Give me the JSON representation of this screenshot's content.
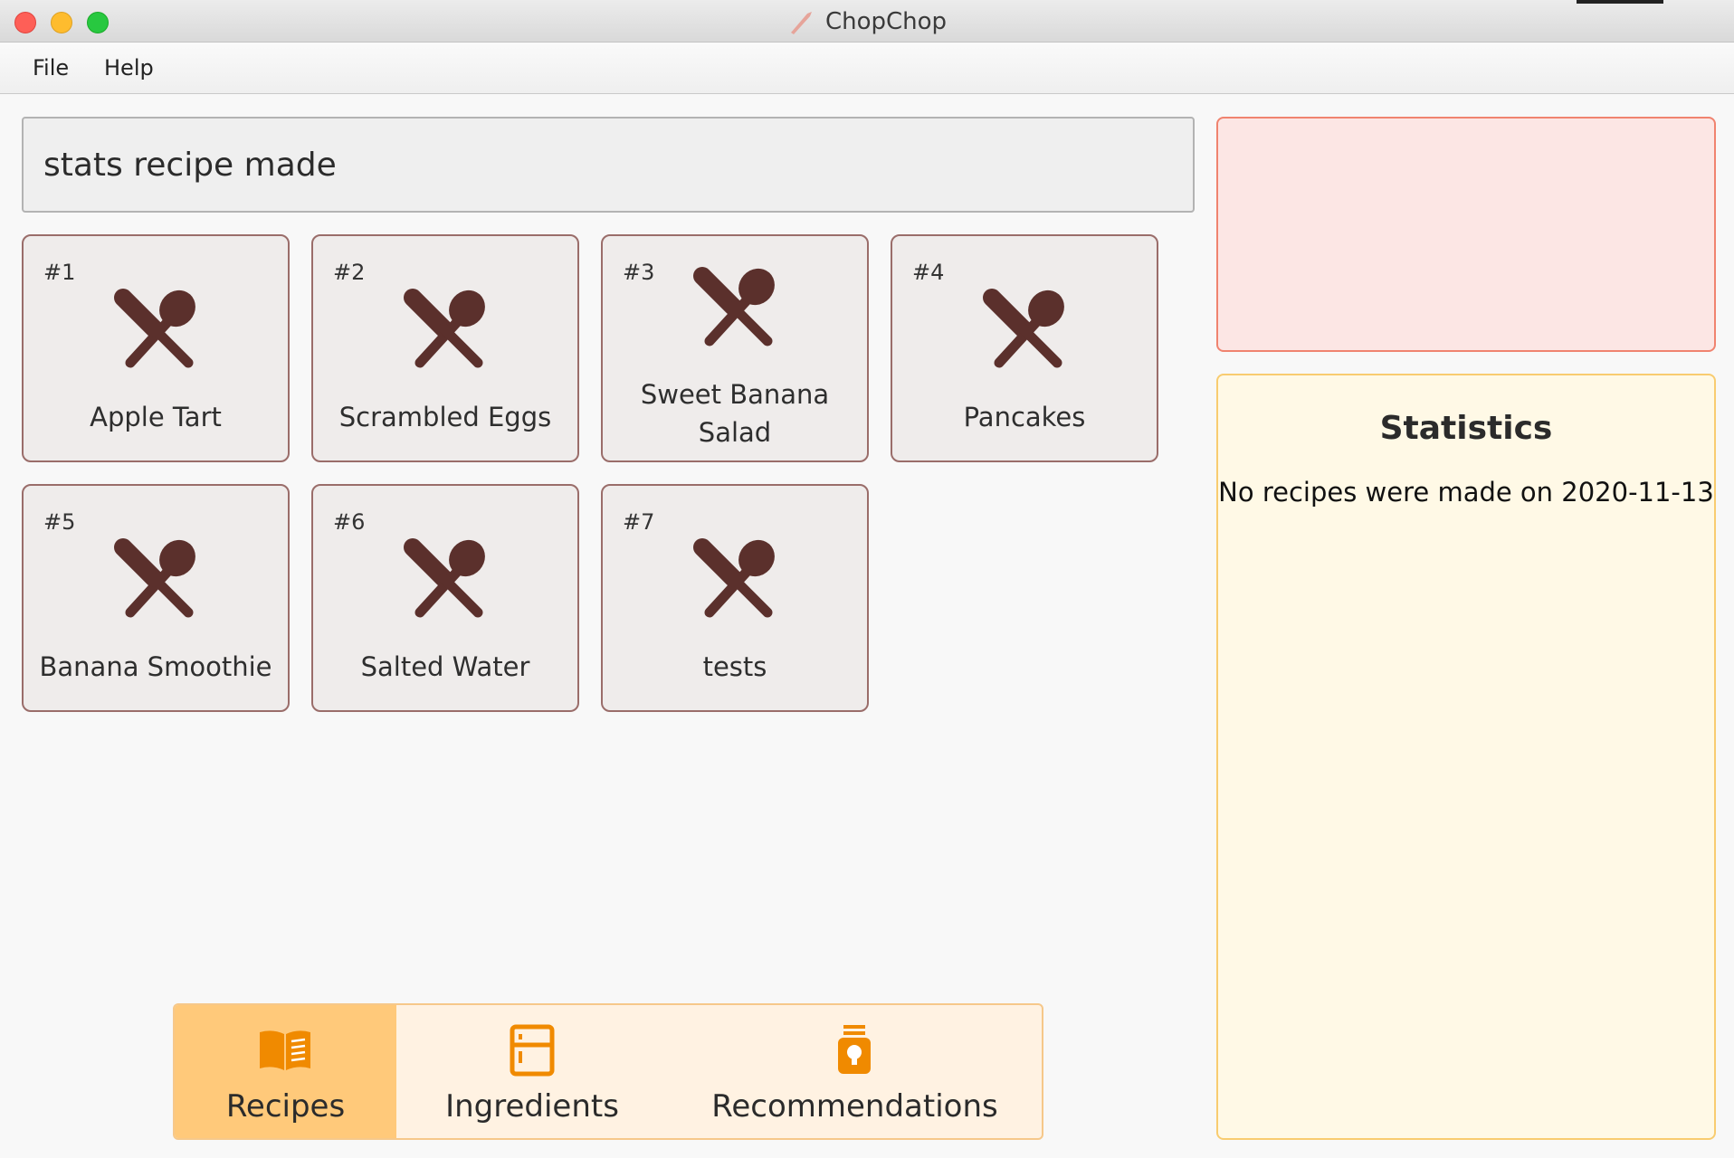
{
  "window": {
    "title": "ChopChop"
  },
  "menu": {
    "items": [
      "File",
      "Help"
    ]
  },
  "command": {
    "value": "stats recipe made"
  },
  "recipes": [
    {
      "index": "#1",
      "name": "Apple Tart"
    },
    {
      "index": "#2",
      "name": "Scrambled Eggs"
    },
    {
      "index": "#3",
      "name": "Sweet Banana Salad"
    },
    {
      "index": "#4",
      "name": "Pancakes"
    },
    {
      "index": "#5",
      "name": "Banana Smoothie"
    },
    {
      "index": "#6",
      "name": "Salted Water"
    },
    {
      "index": "#7",
      "name": "tests"
    }
  ],
  "tabs": [
    {
      "label": "Recipes",
      "icon": "book-icon",
      "active": true
    },
    {
      "label": "Ingredients",
      "icon": "fridge-icon",
      "active": false
    },
    {
      "label": "Recommendations",
      "icon": "lightbulb-icon",
      "active": false
    }
  ],
  "stats": {
    "title": "Statistics",
    "message": "No recipes were made on 2020-11-13"
  },
  "colors": {
    "accent_brown": "#5b302c",
    "tab_active": "#ffc97a",
    "tab_icon": "#f08a00",
    "result_border": "#f0836f",
    "stats_border": "#f8cc70"
  }
}
